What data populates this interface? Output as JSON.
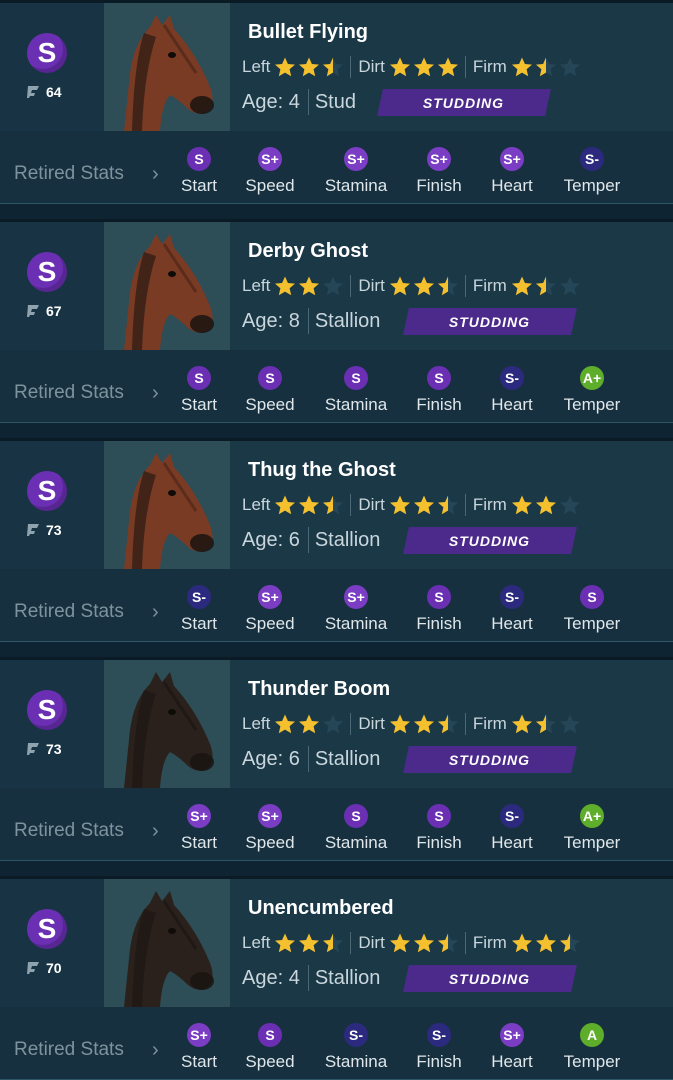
{
  "retired_label": "Retired Stats",
  "horses": [
    {
      "grade": "S",
      "rating": "64",
      "name": "Bullet Flying",
      "surfaces": [
        {
          "label": "Left",
          "stars": 2.5
        },
        {
          "label": "Dirt",
          "stars": 3
        },
        {
          "label": "Firm",
          "stars": 1.5
        }
      ],
      "age": "Age: 4",
      "gender": "Stud",
      "status": "STUDDING",
      "coat": "#7a3b24",
      "stats": [
        {
          "grade": "S",
          "label": "Start"
        },
        {
          "grade": "S+",
          "label": "Speed"
        },
        {
          "grade": "S+",
          "label": "Stamina"
        },
        {
          "grade": "S+",
          "label": "Finish"
        },
        {
          "grade": "S+",
          "label": "Heart"
        },
        {
          "grade": "S-",
          "label": "Temper"
        }
      ]
    },
    {
      "grade": "S",
      "rating": "67",
      "name": "Derby Ghost",
      "surfaces": [
        {
          "label": "Left",
          "stars": 2
        },
        {
          "label": "Dirt",
          "stars": 2.5
        },
        {
          "label": "Firm",
          "stars": 1.5
        }
      ],
      "age": "Age: 8",
      "gender": "Stallion",
      "status": "STUDDING",
      "coat": "#7a3b24",
      "stats": [
        {
          "grade": "S",
          "label": "Start"
        },
        {
          "grade": "S",
          "label": "Speed"
        },
        {
          "grade": "S",
          "label": "Stamina"
        },
        {
          "grade": "S",
          "label": "Finish"
        },
        {
          "grade": "S-",
          "label": "Heart"
        },
        {
          "grade": "A+",
          "label": "Temper"
        }
      ]
    },
    {
      "grade": "S",
      "rating": "73",
      "name": "Thug the Ghost",
      "surfaces": [
        {
          "label": "Left",
          "stars": 2.5
        },
        {
          "label": "Dirt",
          "stars": 2.5
        },
        {
          "label": "Firm",
          "stars": 2
        }
      ],
      "age": "Age: 6",
      "gender": "Stallion",
      "status": "STUDDING",
      "coat": "#7a3b24",
      "stats": [
        {
          "grade": "S-",
          "label": "Start"
        },
        {
          "grade": "S+",
          "label": "Speed"
        },
        {
          "grade": "S+",
          "label": "Stamina"
        },
        {
          "grade": "S",
          "label": "Finish"
        },
        {
          "grade": "S-",
          "label": "Heart"
        },
        {
          "grade": "S",
          "label": "Temper"
        }
      ]
    },
    {
      "grade": "S",
      "rating": "73",
      "name": "Thunder Boom",
      "surfaces": [
        {
          "label": "Left",
          "stars": 2
        },
        {
          "label": "Dirt",
          "stars": 2.5
        },
        {
          "label": "Firm",
          "stars": 1.5
        }
      ],
      "age": "Age: 6",
      "gender": "Stallion",
      "status": "STUDDING",
      "coat": "#2a211c",
      "stats": [
        {
          "grade": "S+",
          "label": "Start"
        },
        {
          "grade": "S+",
          "label": "Speed"
        },
        {
          "grade": "S",
          "label": "Stamina"
        },
        {
          "grade": "S",
          "label": "Finish"
        },
        {
          "grade": "S-",
          "label": "Heart"
        },
        {
          "grade": "A+",
          "label": "Temper"
        }
      ]
    },
    {
      "grade": "S",
      "rating": "70",
      "name": "Unencumbered",
      "surfaces": [
        {
          "label": "Left",
          "stars": 2.5
        },
        {
          "label": "Dirt",
          "stars": 2.5
        },
        {
          "label": "Firm",
          "stars": 2.5
        }
      ],
      "age": "Age: 4",
      "gender": "Stallion",
      "status": "STUDDING",
      "coat": "#2a211c",
      "stats": [
        {
          "grade": "S+",
          "label": "Start"
        },
        {
          "grade": "S",
          "label": "Speed"
        },
        {
          "grade": "S-",
          "label": "Stamina"
        },
        {
          "grade": "S-",
          "label": "Finish"
        },
        {
          "grade": "S+",
          "label": "Heart"
        },
        {
          "grade": "A",
          "label": "Temper"
        }
      ]
    }
  ]
}
